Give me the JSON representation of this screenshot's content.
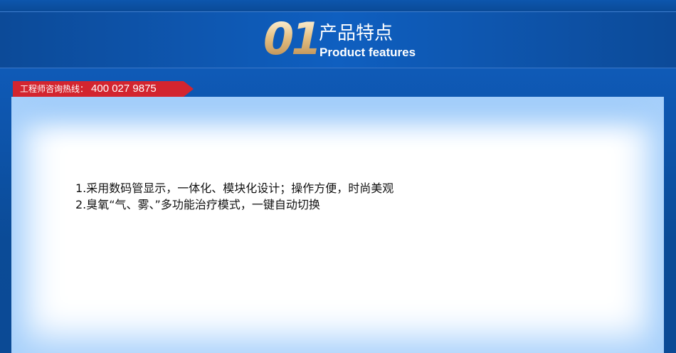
{
  "header": {
    "number": "01",
    "title_cn": "产品特点",
    "title_en": "Product features"
  },
  "hotline": {
    "label": "工程师咨询热线：",
    "number": "400 027 9875",
    "color": "#d3252f"
  },
  "features": [
    "1.采用数码管显示，一体化、模块化设计；操作方便，时尚美观",
    "2.臭氧“气、雾、”多功能治疗模式，一键自动切换"
  ],
  "colors": {
    "background": "#0d4d9a",
    "panel": "#ffffff",
    "accent_gold": "#e2c08b"
  }
}
